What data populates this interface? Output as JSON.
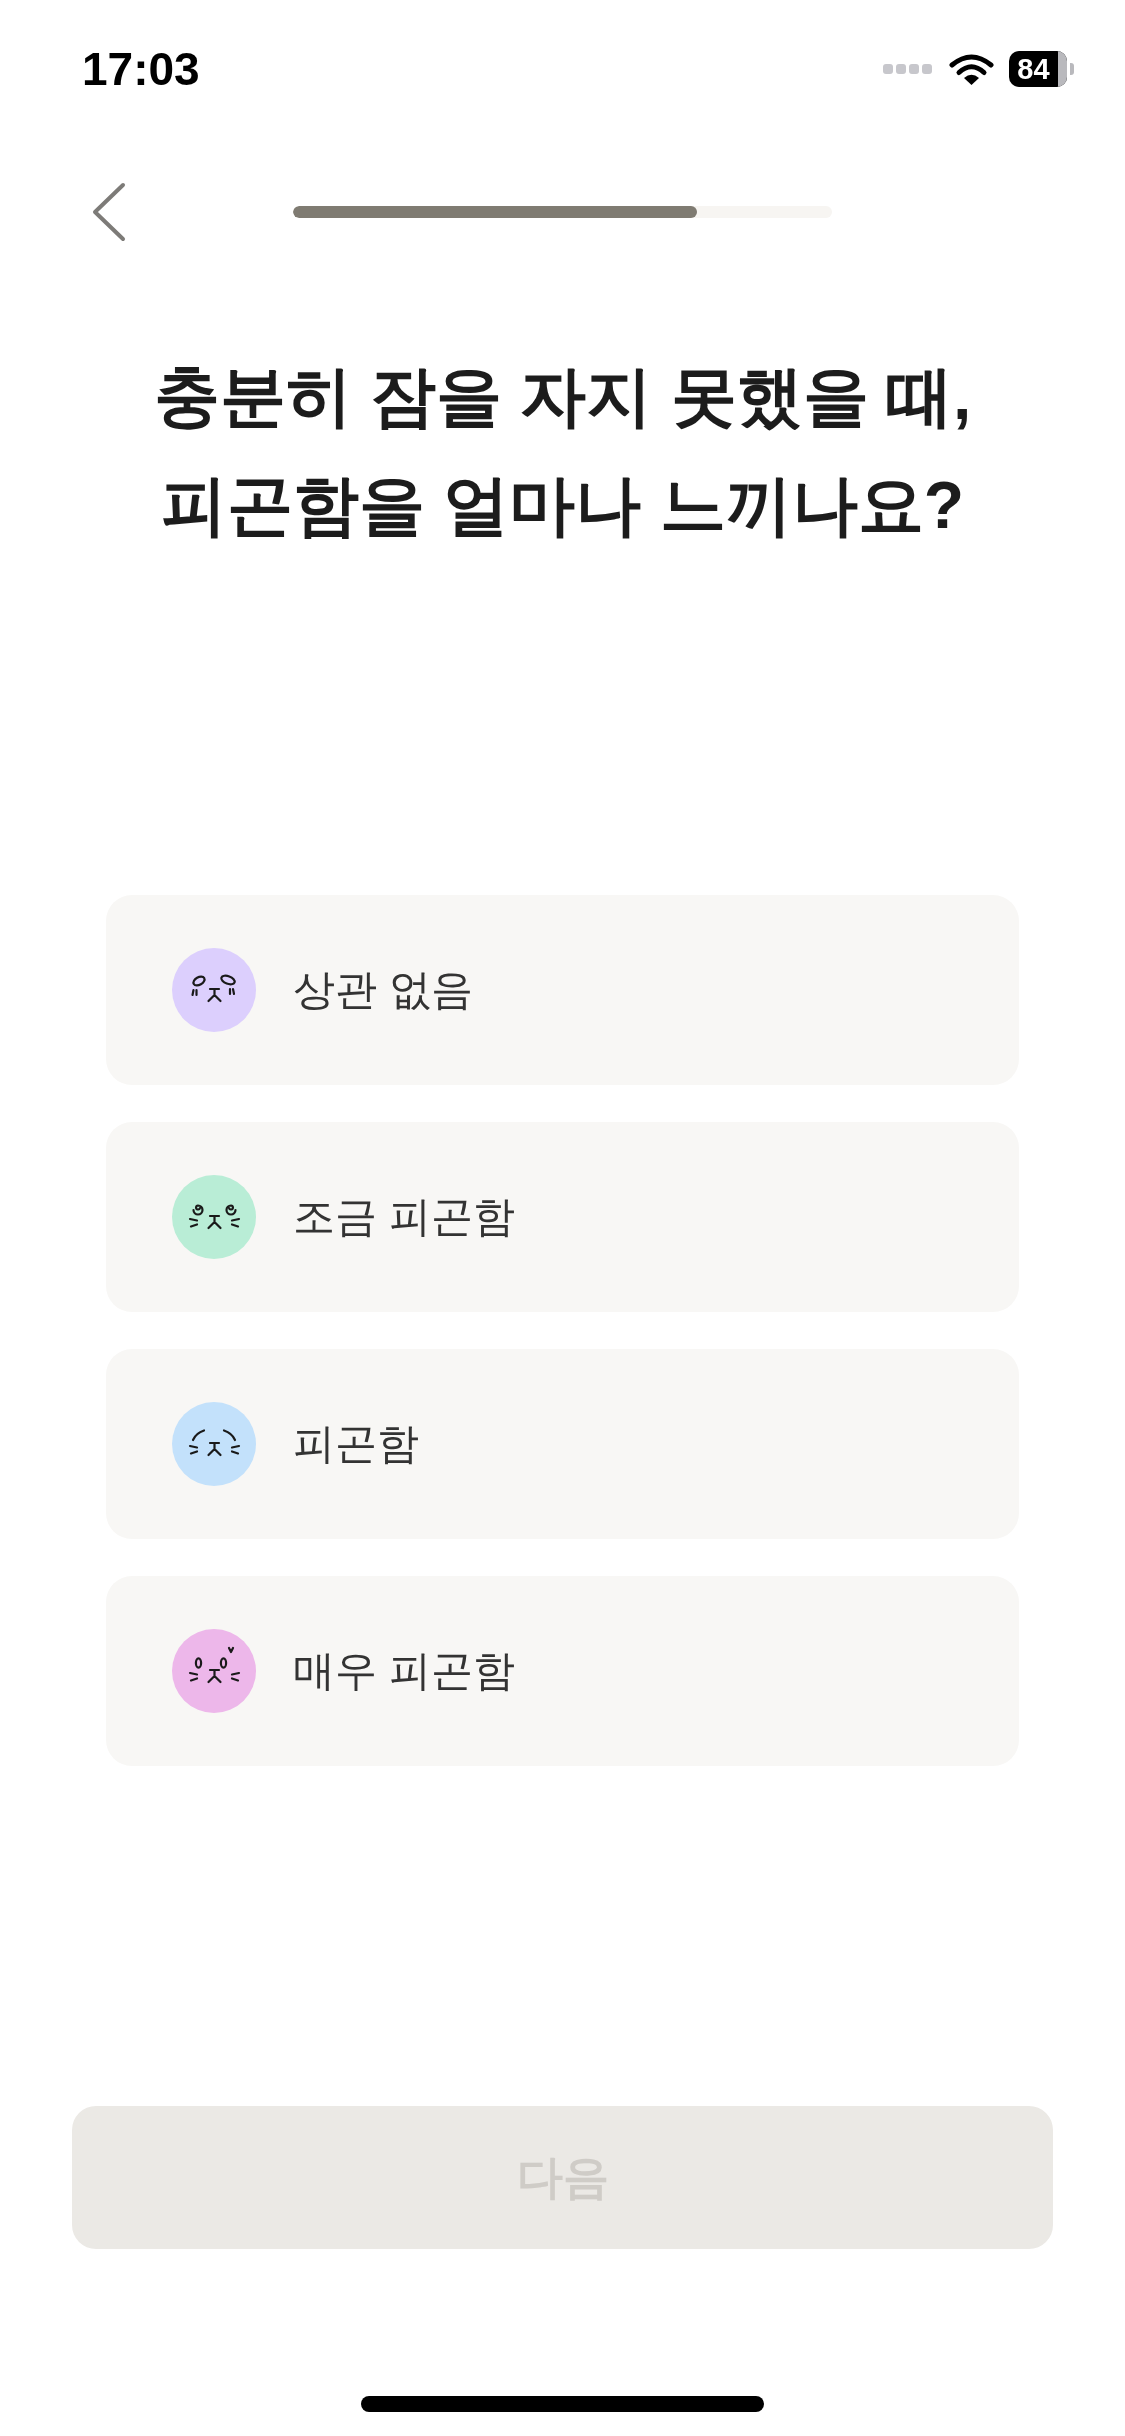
{
  "status_bar": {
    "time": "17:03",
    "battery": "84"
  },
  "header": {
    "progress": {
      "level": 0.75
    }
  },
  "question": {
    "title": "충분히 잠을 자지 못했을 때,\n피곤함을 얼마나 느끼나요?"
  },
  "options": [
    {
      "label": "상관 없음",
      "color": "#dccffd",
      "selected": false
    },
    {
      "label": "조금 피곤함",
      "color": "#b9edd6",
      "selected": false
    },
    {
      "label": "피곤함",
      "color": "#c3e1fb",
      "selected": false
    },
    {
      "label": "매우 피곤함",
      "color": "#edb7ea",
      "selected": false
    }
  ],
  "next_button": {
    "label": "다음",
    "disabled": true
  }
}
